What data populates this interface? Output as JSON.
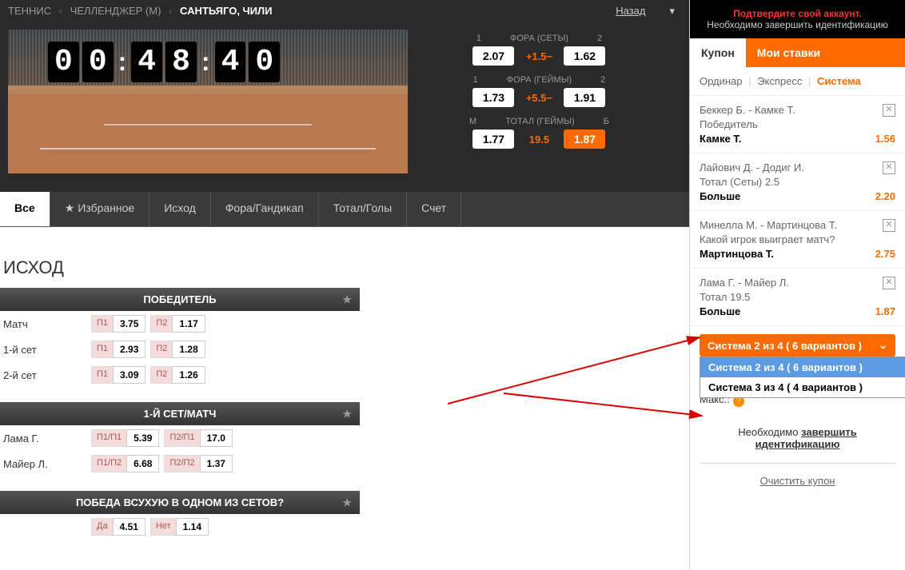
{
  "breadcrumb": {
    "sport": "ТЕННИС",
    "league": "ЧЕЛЛЕНДЖЕР (М)",
    "event": "САНТЬЯГО, ЧИЛИ",
    "back": "Назад"
  },
  "timer": {
    "d1": "0",
    "d2": "0",
    "d3": "4",
    "d4": "8",
    "d5": "4",
    "d6": "0"
  },
  "odds_panel": [
    {
      "h1": "1",
      "title": "ФОРА (СЕТЫ)",
      "h2": "2",
      "v1": "2.07",
      "mid": "+1.5−",
      "v2": "1.62",
      "sel": 0
    },
    {
      "h1": "1",
      "title": "ФОРА (ГЕЙМЫ)",
      "h2": "2",
      "v1": "1.73",
      "mid": "+5.5−",
      "v2": "1.91",
      "sel": 0
    },
    {
      "h1": "М",
      "title": "ТОТАЛ (ГЕЙМЫ)",
      "h2": "Б",
      "v1": "1.77",
      "mid": "19.5",
      "v2": "1.87",
      "sel": 2
    }
  ],
  "tabs": [
    {
      "label": "Все",
      "active": true
    },
    {
      "label": "Избранное",
      "star": true
    },
    {
      "label": "Исход"
    },
    {
      "label": "Фора/Гандикап"
    },
    {
      "label": "Тотал/Голы"
    },
    {
      "label": "Счет"
    }
  ],
  "section": "ИСХОД",
  "markets": [
    {
      "title": "ПОБЕДИТЕЛЬ",
      "rows": [
        {
          "label": "Матч",
          "cells": [
            {
              "n": "П1",
              "v": "3.75"
            },
            {
              "n": "П2",
              "v": "1.17"
            }
          ]
        },
        {
          "label": "1-й сет",
          "cells": [
            {
              "n": "П1",
              "v": "2.93"
            },
            {
              "n": "П2",
              "v": "1.28"
            }
          ]
        },
        {
          "label": "2-й сет",
          "cells": [
            {
              "n": "П1",
              "v": "3.09"
            },
            {
              "n": "П2",
              "v": "1.26"
            }
          ]
        }
      ]
    },
    {
      "title": "1-Й СЕТ/МАТЧ",
      "rows": [
        {
          "label": "Лама Г.",
          "cells": [
            {
              "n": "П1/П1",
              "v": "5.39"
            },
            {
              "n": "П2/П1",
              "v": "17.0"
            }
          ]
        },
        {
          "label": "Майер Л.",
          "cells": [
            {
              "n": "П1/П2",
              "v": "6.68"
            },
            {
              "n": "П2/П2",
              "v": "1.37"
            }
          ]
        }
      ]
    },
    {
      "title": "ПОБЕДА ВСУХУЮ В ОДНОМ ИЗ СЕТОВ?",
      "rows": [
        {
          "label": "",
          "cells": [
            {
              "n": "Да",
              "v": "4.51"
            },
            {
              "n": "Нет",
              "v": "1.14"
            }
          ]
        }
      ]
    }
  ],
  "verify": {
    "title": "Подтвердите свой аккаунт.",
    "sub": "Необходимо завершить идентификацию"
  },
  "coupon_tabs": [
    {
      "label": "Купон",
      "active": true
    },
    {
      "label": "Мои ставки"
    }
  ],
  "bet_types": {
    "single": "Ординар",
    "express": "Экспресс",
    "system": "Система"
  },
  "slip": [
    {
      "match": "Беккер Б. - Камке Т.",
      "market": "Победитель",
      "pick": "Камке Т.",
      "odds": "1.56"
    },
    {
      "match": "Лайович Д. - Додиг И.",
      "market": "Тотал (Сеты) 2.5",
      "pick": "Больше",
      "odds": "2.20"
    },
    {
      "match": "Минелла М. - Мартинцова Т.",
      "market": "Какой игрок выиграет матч?",
      "pick": "Мартинцова Т.",
      "odds": "2.75"
    },
    {
      "match": "Лама Г. - Майер Л.",
      "market": "Тотал 19.5",
      "pick": "Больше",
      "odds": "1.87"
    }
  ],
  "system": {
    "selected": "Система 2 из 4 ( 6 вариантов )",
    "options": [
      "Система 2 из 4 ( 6 вариантов )",
      "Система 3 из 4 ( 4 вариантов )"
    ]
  },
  "max_label": "Макс.:",
  "verify_link": {
    "pre": "Необходимо ",
    "a": "завершить идентификацию"
  },
  "clear": "Очистить купон"
}
